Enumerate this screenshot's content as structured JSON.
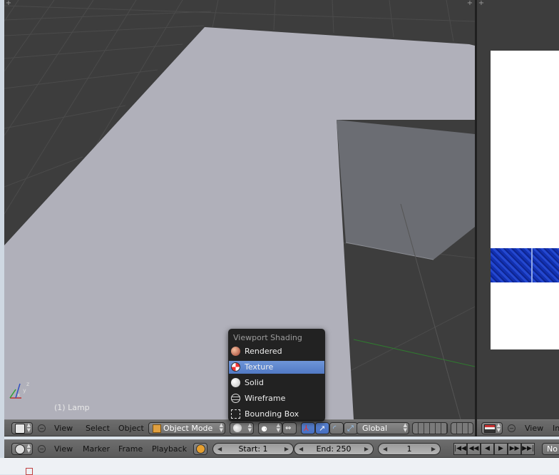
{
  "viewport": {
    "object_label": "(1) Lamp"
  },
  "shading_popup": {
    "title": "Viewport Shading",
    "items": [
      {
        "label": "Rendered",
        "icon": "rendered-sphere-icon"
      },
      {
        "label": "Texture",
        "icon": "texture-checker-icon",
        "selected": true
      },
      {
        "label": "Solid",
        "icon": "solid-sphere-icon"
      },
      {
        "label": "Wireframe",
        "icon": "wireframe-sphere-icon"
      },
      {
        "label": "Bounding Box",
        "icon": "bounding-box-icon"
      }
    ]
  },
  "view3d_header": {
    "menu": [
      "View",
      "Select",
      "Object"
    ],
    "mode": "Object Mode",
    "orientation": "Global"
  },
  "image_editor_header": {
    "menu": [
      "View",
      "In"
    ]
  },
  "timeline_header": {
    "menu": [
      "View",
      "Marker",
      "Frame",
      "Playback"
    ],
    "start": "Start: 1",
    "end": "End: 250",
    "current_frame": "1",
    "keying_label": "No"
  },
  "colors": {
    "selected_highlight": "#5680c8",
    "header_bg": "#666666",
    "viewport_bg": "#3d3d3d",
    "plane": "#b0b0b8",
    "cube_side": "#6a6c72"
  }
}
